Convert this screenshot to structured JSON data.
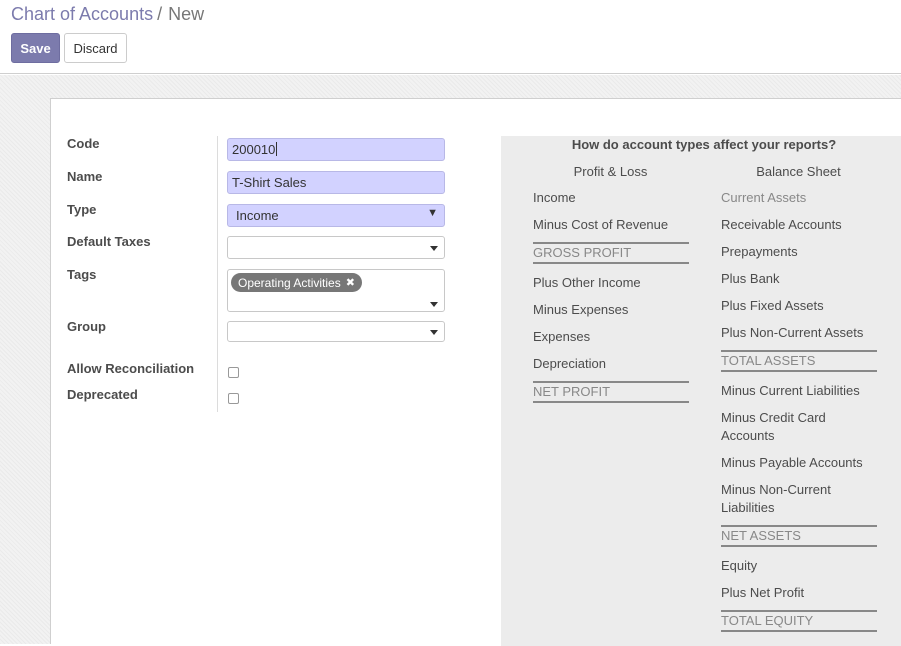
{
  "breadcrumb": {
    "parent": "Chart of Accounts",
    "separator": "/",
    "current": "New"
  },
  "buttons": {
    "save": "Save",
    "discard": "Discard"
  },
  "form": {
    "code": {
      "label": "Code",
      "value": "200010"
    },
    "name": {
      "label": "Name",
      "value": "T-Shirt Sales"
    },
    "type": {
      "label": "Type",
      "value": "Income"
    },
    "default_taxes": {
      "label": "Default Taxes",
      "value": ""
    },
    "tags": {
      "label": "Tags",
      "items": [
        "Operating Activities"
      ],
      "remove_glyph": "✖"
    },
    "group": {
      "label": "Group",
      "value": ""
    },
    "allow_reconciliation": {
      "label": "Allow Reconciliation",
      "checked": false
    },
    "deprecated": {
      "label": "Deprecated",
      "checked": false
    }
  },
  "info": {
    "title": "How do account types affect your reports?",
    "profit_loss": {
      "heading": "Profit & Loss",
      "rows": [
        "Income",
        "Minus Cost of Revenue",
        "GROSS PROFIT",
        "Plus Other Income",
        "Minus Expenses",
        "Expenses",
        "Depreciation",
        "NET PROFIT"
      ]
    },
    "balance_sheet": {
      "heading": "Balance Sheet",
      "rows": [
        "Current Assets",
        "Receivable Accounts",
        "Prepayments",
        "Plus Bank",
        "Plus Fixed Assets",
        "Plus Non-Current Assets",
        "TOTAL ASSETS",
        "Minus Current Liabilities",
        "Minus Credit Card Accounts",
        "Minus Payable Accounts",
        "Minus Non-Current Liabilities",
        "NET ASSETS",
        "Equity",
        "Plus Net Profit",
        "TOTAL EQUITY"
      ]
    }
  },
  "colors": {
    "primary": "#7c7bad",
    "required_field": "#d2d2ff",
    "info_panel": "#ececec",
    "muted_text": "#888888"
  }
}
